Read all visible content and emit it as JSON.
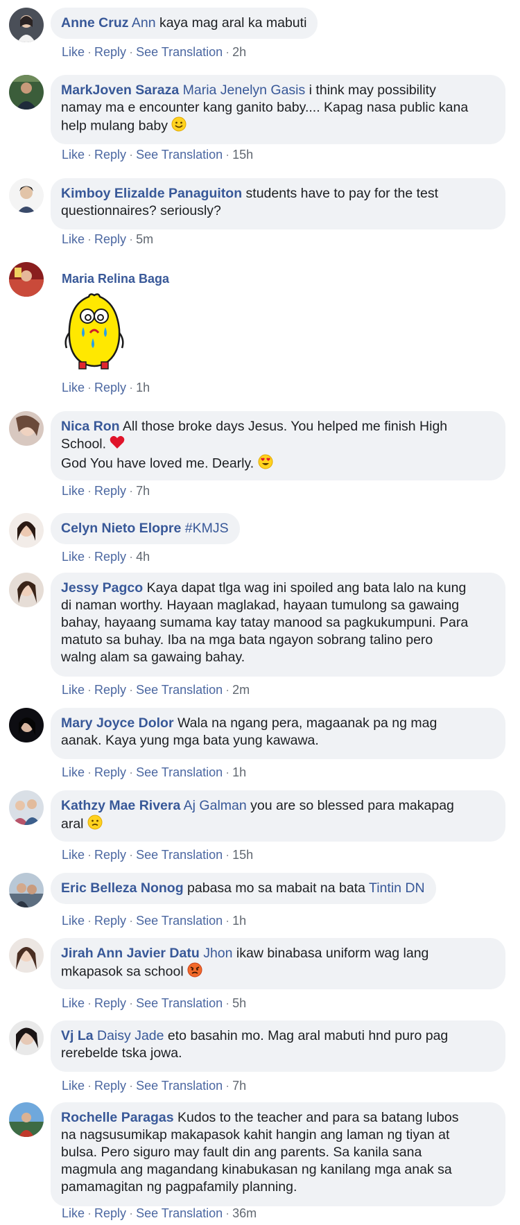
{
  "actions": {
    "like": "Like",
    "reply": "Reply",
    "see_translation": "See Translation",
    "separator": "·"
  },
  "comments": [
    {
      "author": "Anne Cruz",
      "mention": "Ann",
      "text": " kaya mag aral ka mabuti",
      "time": "2h"
    },
    {
      "author": "MarkJoven Saraza",
      "mention": "Maria Jenelyn Gasis",
      "line1": " i think may possibility",
      "line2": "namay ma e encounter kang ganito baby.... Kapag nasa public kana",
      "line3": "help mulang baby",
      "emoji": "smiling-emoji",
      "time": "15h"
    },
    {
      "author": "Kimboy Elizalde Panaguiton",
      "line1": " students have to pay for the test",
      "line2": "questionnaires? seriously?",
      "time": "5m"
    },
    {
      "author": "Maria Relina Baga",
      "sticker": "crying-lemon-sticker",
      "time": "1h"
    },
    {
      "author": "Nica Ron",
      "line1": " All those broke days Jesus. You helped me finish High",
      "line2": "School.",
      "line3": "God You have loved me. Dearly.",
      "emoji1": "heart-emoji",
      "emoji2": "heart-eyes-emoji",
      "time": "7h"
    },
    {
      "author": "Celyn Nieto Elopre",
      "mention": "#KMJS",
      "time": "4h"
    },
    {
      "author": "Jessy Pagco",
      "line1": " Kaya dapat tlga wag ini spoiled ang bata lalo na kung",
      "line2": "di naman worthy. Hayaan maglakad, hayaan tumulong sa gawaing",
      "line3": "bahay, hayaang sumama kay tatay manood sa pagkukumpuni. Para",
      "line4": "matuto sa buhay. Iba na mga bata ngayon sobrang talino pero",
      "line5": "walng alam sa gawaing bahay.",
      "time": "2m"
    },
    {
      "author": "Mary Joyce Dolor",
      "line1": " Wala na ngang pera, magaanak pa ng mag",
      "line2": "aanak. Kaya yung mga bata yung kawawa.",
      "time": "1h"
    },
    {
      "author": "Kathzy Mae Rivera",
      "mention": "Aj Galman",
      "line1": " you are so blessed para makapag",
      "line2": "aral",
      "emoji": "slightly-frowning-emoji",
      "time": "15h"
    },
    {
      "author": "Eric Belleza Nonog",
      "text": " pabasa mo sa mabait na bata ",
      "mention": "Tintin DN",
      "time": "1h"
    },
    {
      "author": "Jirah Ann Javier Datu",
      "mention": "Jhon",
      "line1": " ikaw binabasa uniform wag lang",
      "line2": "mkapasok sa school",
      "emoji": "angry-emoji",
      "time": "5h"
    },
    {
      "author": "Vj La",
      "mention": "Daisy Jade",
      "line1": " eto basahin mo. Mag aral mabuti hnd puro pag",
      "line2": "rerebelde tska jowa.",
      "time": "7h"
    },
    {
      "author": "Rochelle Paragas",
      "line1": " Kudos to the teacher and para sa batang lubos",
      "line2": "na nagsusumikap makapasok kahit hangin ang laman ng tiyan at",
      "line3": "bulsa. Pero siguro may fault din ang parents. Sa kanila sana",
      "line4": "magmula ang magandang kinabukasan ng kanilang mga anak sa",
      "line5": "pamamagitan ng pagpafamily planning.",
      "time": "36m"
    }
  ],
  "colors": {
    "author": "#385898",
    "bubble": "#f0f2f5",
    "meta": "#606770",
    "link": "#4b67a1"
  }
}
